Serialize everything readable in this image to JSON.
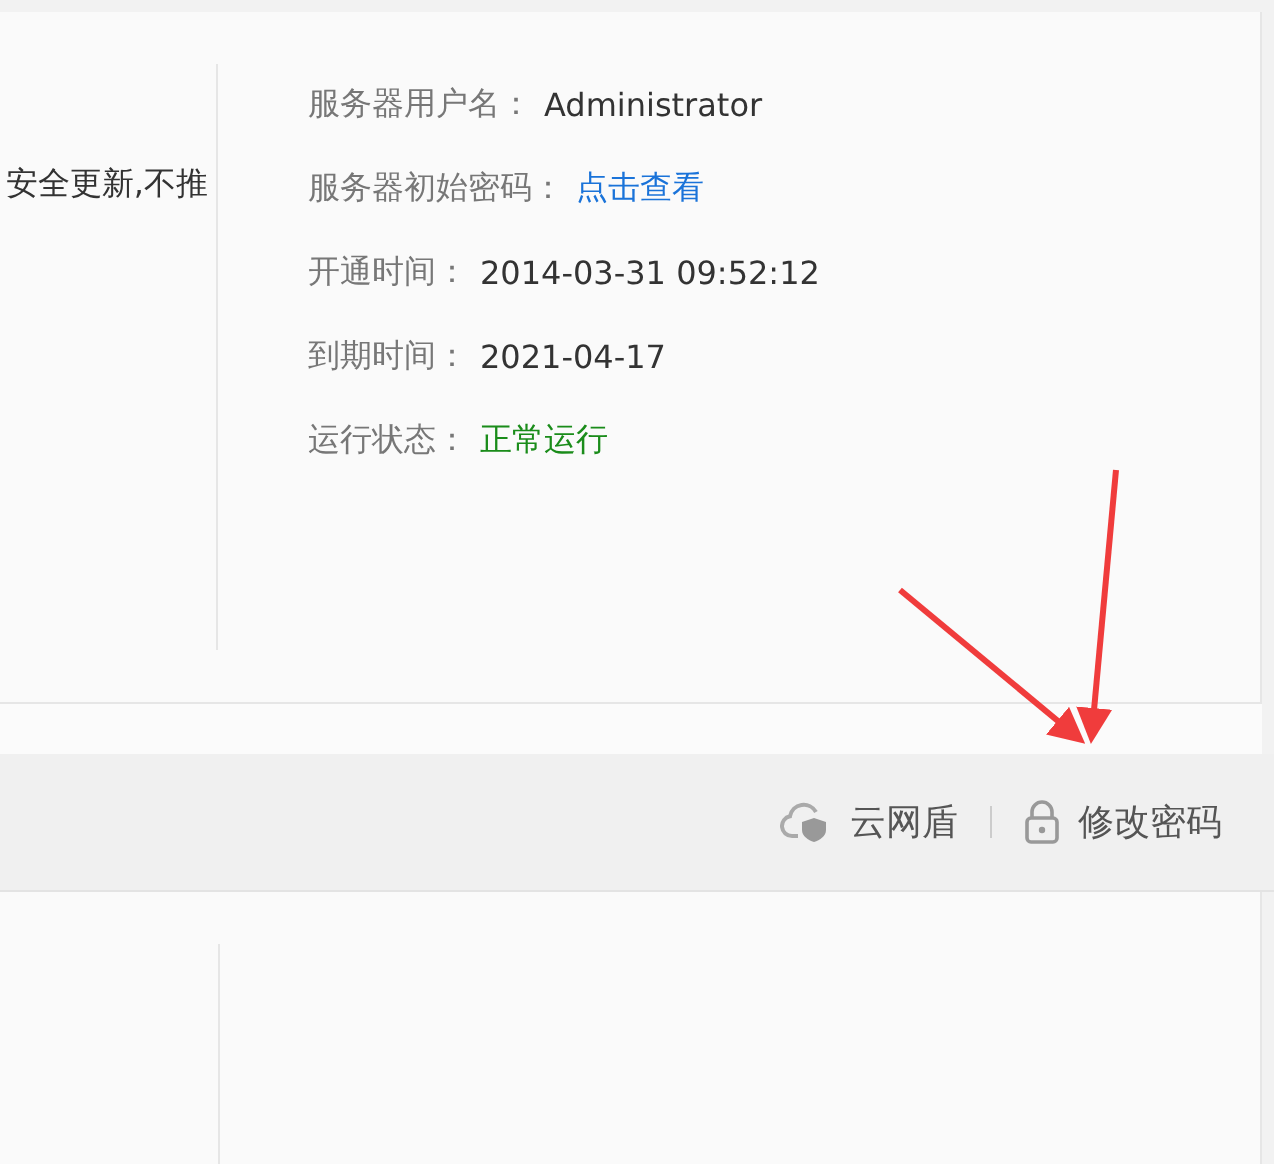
{
  "server_card": {
    "note": "安全更新,不推",
    "details": [
      {
        "label": "服务器用户名：",
        "value": "Administrator",
        "kind": "text"
      },
      {
        "label": "服务器初始密码：",
        "value": "点击查看",
        "kind": "link"
      },
      {
        "label": "开通时间：",
        "value": "2014-03-31 09:52:12",
        "kind": "text"
      },
      {
        "label": "到期时间：",
        "value": "2021-04-17",
        "kind": "text"
      },
      {
        "label": "运行状态：",
        "value": "正常运行",
        "kind": "status"
      }
    ]
  },
  "actions": [
    {
      "label": "云网盾",
      "kind": "firewall"
    },
    {
      "label": "修改密码",
      "kind": "password"
    }
  ]
}
